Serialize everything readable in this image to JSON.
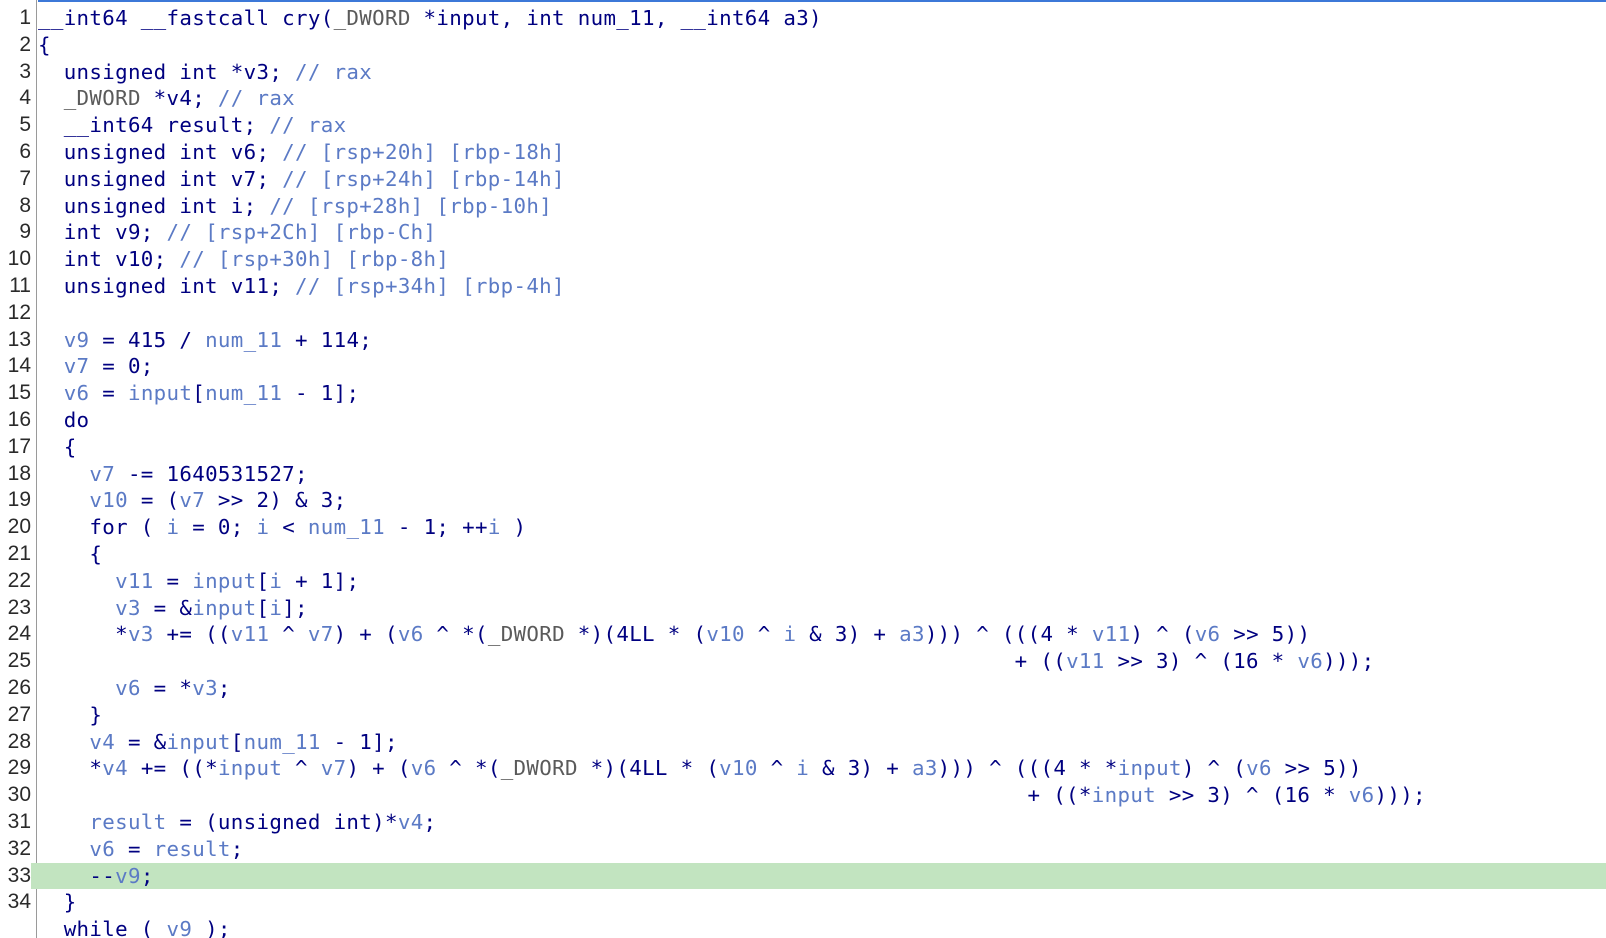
{
  "editor": {
    "current_line": 33,
    "colors": {
      "text": "#000080",
      "variable": "#5b7ac5",
      "comment": "#5b7ac5",
      "type_gray": "#5a5a5a",
      "current_line_bg": "#c2e4c0",
      "top_rule": "#3c78d8"
    },
    "lines": [
      {
        "n": "1",
        "tokens": [
          [
            "t",
            "__int64 __fastcall cry("
          ],
          [
            "g",
            "_DWORD"
          ],
          [
            "t",
            " *input, int num_11, __int64 a3)"
          ]
        ]
      },
      {
        "n": "2",
        "tokens": [
          [
            "t",
            "{"
          ]
        ]
      },
      {
        "n": "3",
        "tokens": [
          [
            "t",
            "  unsigned int *v3; "
          ],
          [
            "c",
            "// rax"
          ]
        ]
      },
      {
        "n": "4",
        "tokens": [
          [
            "t",
            "  "
          ],
          [
            "g",
            "_DWORD"
          ],
          [
            "t",
            " *v4; "
          ],
          [
            "c",
            "// rax"
          ]
        ]
      },
      {
        "n": "5",
        "tokens": [
          [
            "t",
            "  __int64 result; "
          ],
          [
            "c",
            "// rax"
          ]
        ]
      },
      {
        "n": "6",
        "tokens": [
          [
            "t",
            "  unsigned int v6; "
          ],
          [
            "c",
            "// [rsp+20h] [rbp-18h]"
          ]
        ]
      },
      {
        "n": "7",
        "tokens": [
          [
            "t",
            "  unsigned int v7; "
          ],
          [
            "c",
            "// [rsp+24h] [rbp-14h]"
          ]
        ]
      },
      {
        "n": "8",
        "tokens": [
          [
            "t",
            "  unsigned int i; "
          ],
          [
            "c",
            "// [rsp+28h] [rbp-10h]"
          ]
        ]
      },
      {
        "n": "9",
        "tokens": [
          [
            "t",
            "  int v9; "
          ],
          [
            "c",
            "// [rsp+2Ch] [rbp-Ch]"
          ]
        ]
      },
      {
        "n": "10",
        "tokens": [
          [
            "t",
            "  int v10; "
          ],
          [
            "c",
            "// [rsp+30h] [rbp-8h]"
          ]
        ]
      },
      {
        "n": "11",
        "tokens": [
          [
            "t",
            "  unsigned int v11; "
          ],
          [
            "c",
            "// [rsp+34h] [rbp-4h]"
          ]
        ]
      },
      {
        "n": "12",
        "tokens": []
      },
      {
        "n": "13",
        "tokens": [
          [
            "t",
            "  "
          ],
          [
            "v",
            "v9"
          ],
          [
            "t",
            " = 415 / "
          ],
          [
            "v",
            "num_11"
          ],
          [
            "t",
            " + 114;"
          ]
        ]
      },
      {
        "n": "14",
        "tokens": [
          [
            "t",
            "  "
          ],
          [
            "v",
            "v7"
          ],
          [
            "t",
            " = 0;"
          ]
        ]
      },
      {
        "n": "15",
        "tokens": [
          [
            "t",
            "  "
          ],
          [
            "v",
            "v6"
          ],
          [
            "t",
            " = "
          ],
          [
            "v",
            "input"
          ],
          [
            "t",
            "["
          ],
          [
            "v",
            "num_11"
          ],
          [
            "t",
            " - 1];"
          ]
        ]
      },
      {
        "n": "16",
        "tokens": [
          [
            "t",
            "  do"
          ]
        ]
      },
      {
        "n": "17",
        "tokens": [
          [
            "t",
            "  {"
          ]
        ]
      },
      {
        "n": "18",
        "tokens": [
          [
            "t",
            "    "
          ],
          [
            "v",
            "v7"
          ],
          [
            "t",
            " -= 1640531527;"
          ]
        ]
      },
      {
        "n": "19",
        "tokens": [
          [
            "t",
            "    "
          ],
          [
            "v",
            "v10"
          ],
          [
            "t",
            " = ("
          ],
          [
            "v",
            "v7"
          ],
          [
            "t",
            " >> 2) & 3;"
          ]
        ]
      },
      {
        "n": "20",
        "tokens": [
          [
            "t",
            "    for ( "
          ],
          [
            "v",
            "i"
          ],
          [
            "t",
            " = 0; "
          ],
          [
            "v",
            "i"
          ],
          [
            "t",
            " < "
          ],
          [
            "v",
            "num_11"
          ],
          [
            "t",
            " - 1; ++"
          ],
          [
            "v",
            "i"
          ],
          [
            "t",
            " )"
          ]
        ]
      },
      {
        "n": "21",
        "tokens": [
          [
            "t",
            "    {"
          ]
        ]
      },
      {
        "n": "22",
        "tokens": [
          [
            "t",
            "      "
          ],
          [
            "v",
            "v11"
          ],
          [
            "t",
            " = "
          ],
          [
            "v",
            "input"
          ],
          [
            "t",
            "["
          ],
          [
            "v",
            "i"
          ],
          [
            "t",
            " + 1];"
          ]
        ]
      },
      {
        "n": "23",
        "tokens": [
          [
            "t",
            "      "
          ],
          [
            "v",
            "v3"
          ],
          [
            "t",
            " = &"
          ],
          [
            "v",
            "input"
          ],
          [
            "t",
            "["
          ],
          [
            "v",
            "i"
          ],
          [
            "t",
            "];"
          ]
        ]
      },
      {
        "n": "24",
        "tokens": [
          [
            "t",
            "      *"
          ],
          [
            "v",
            "v3"
          ],
          [
            "t",
            " += (("
          ],
          [
            "v",
            "v11"
          ],
          [
            "t",
            " ^ "
          ],
          [
            "v",
            "v7"
          ],
          [
            "t",
            ") + ("
          ],
          [
            "v",
            "v6"
          ],
          [
            "t",
            " ^ *("
          ],
          [
            "g",
            "_DWORD"
          ],
          [
            "t",
            " *)(4LL * ("
          ],
          [
            "v",
            "v10"
          ],
          [
            "t",
            " ^ "
          ],
          [
            "v",
            "i"
          ],
          [
            "t",
            " & 3) + "
          ],
          [
            "v",
            "a3"
          ],
          [
            "t",
            "))) ^ (((4 * "
          ],
          [
            "v",
            "v11"
          ],
          [
            "t",
            ") ^ ("
          ],
          [
            "v",
            "v6"
          ],
          [
            "t",
            " >> 5))"
          ]
        ]
      },
      {
        "n": "25",
        "tokens": [
          [
            "t",
            "                                                                            + (("
          ],
          [
            "v",
            "v11"
          ],
          [
            "t",
            " >> 3) ^ (16 * "
          ],
          [
            "v",
            "v6"
          ],
          [
            "t",
            ")));"
          ]
        ]
      },
      {
        "n": "26",
        "tokens": [
          [
            "t",
            "      "
          ],
          [
            "v",
            "v6"
          ],
          [
            "t",
            " = *"
          ],
          [
            "v",
            "v3"
          ],
          [
            "t",
            ";"
          ]
        ]
      },
      {
        "n": "27",
        "tokens": [
          [
            "t",
            "    }"
          ]
        ]
      },
      {
        "n": "28",
        "tokens": [
          [
            "t",
            "    "
          ],
          [
            "v",
            "v4"
          ],
          [
            "t",
            " = &"
          ],
          [
            "v",
            "input"
          ],
          [
            "t",
            "["
          ],
          [
            "v",
            "num_11"
          ],
          [
            "t",
            " - 1];"
          ]
        ]
      },
      {
        "n": "29",
        "tokens": [
          [
            "t",
            "    *"
          ],
          [
            "v",
            "v4"
          ],
          [
            "t",
            " += ((*"
          ],
          [
            "v",
            "input"
          ],
          [
            "t",
            " ^ "
          ],
          [
            "v",
            "v7"
          ],
          [
            "t",
            ") + ("
          ],
          [
            "v",
            "v6"
          ],
          [
            "t",
            " ^ *("
          ],
          [
            "g",
            "_DWORD"
          ],
          [
            "t",
            " *)(4LL * ("
          ],
          [
            "v",
            "v10"
          ],
          [
            "t",
            " ^ "
          ],
          [
            "v",
            "i"
          ],
          [
            "t",
            " & 3) + "
          ],
          [
            "v",
            "a3"
          ],
          [
            "t",
            "))) ^ (((4 * *"
          ],
          [
            "v",
            "input"
          ],
          [
            "t",
            ") ^ ("
          ],
          [
            "v",
            "v6"
          ],
          [
            "t",
            " >> 5))"
          ]
        ]
      },
      {
        "n": "30",
        "tokens": [
          [
            "t",
            "                                                                             + ((*"
          ],
          [
            "v",
            "input"
          ],
          [
            "t",
            " >> 3) ^ (16 * "
          ],
          [
            "v",
            "v6"
          ],
          [
            "t",
            ")));"
          ]
        ]
      },
      {
        "n": "31",
        "tokens": [
          [
            "t",
            "    "
          ],
          [
            "v",
            "result"
          ],
          [
            "t",
            " = (unsigned int)*"
          ],
          [
            "v",
            "v4"
          ],
          [
            "t",
            ";"
          ]
        ]
      },
      {
        "n": "32",
        "tokens": [
          [
            "t",
            "    "
          ],
          [
            "v",
            "v6"
          ],
          [
            "t",
            " = "
          ],
          [
            "v",
            "result"
          ],
          [
            "t",
            ";"
          ]
        ]
      },
      {
        "n": "33",
        "tokens": [
          [
            "t",
            "    --"
          ],
          [
            "v",
            "v9"
          ],
          [
            "t",
            ";"
          ]
        ]
      },
      {
        "n": "34",
        "tokens": [
          [
            "t",
            "  }"
          ]
        ]
      },
      {
        "n": "",
        "tokens": [
          [
            "t",
            "  while ( "
          ],
          [
            "v",
            "v9"
          ],
          [
            "t",
            " );"
          ]
        ]
      }
    ]
  }
}
